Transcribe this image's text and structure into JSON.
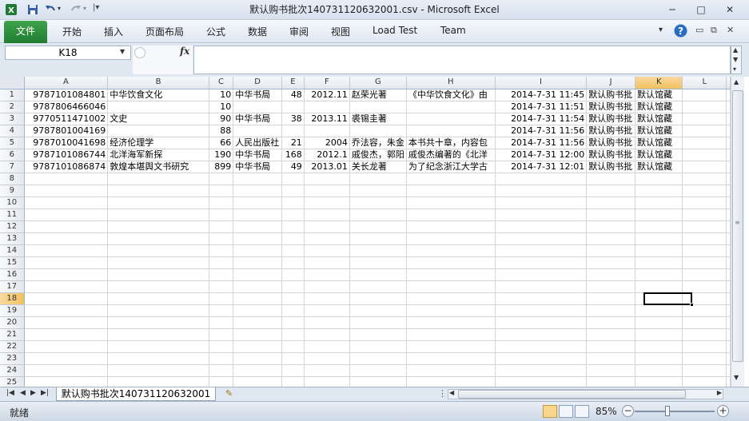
{
  "window": {
    "title": "默认购书批次140731120632001.csv  -  Microsoft Excel",
    "minimize": "─",
    "maximize": "□",
    "close": "✕"
  },
  "ribbon": {
    "tabs": [
      "文件",
      "开始",
      "插入",
      "页面布局",
      "公式",
      "数据",
      "审阅",
      "视图",
      "Load Test",
      "Team"
    ]
  },
  "formula_bar": {
    "name_box": "K18",
    "fx": "fx",
    "content": ""
  },
  "grid": {
    "columns": [
      "A",
      "B",
      "C",
      "D",
      "E",
      "F",
      "G",
      "H",
      "I",
      "J",
      "K",
      "L"
    ],
    "selected_column": "K",
    "selected_row": 18,
    "row_count": 25,
    "rows": [
      [
        "9787101084801",
        "中华饮食文化",
        "10",
        "中华书局",
        "48",
        "2012.11",
        "赵荣光著",
        "《中华饮食文化》由",
        "2014-7-31 11:45",
        "默认购书批",
        "默认馆藏"
      ],
      [
        "9787806466046",
        "",
        "10",
        "",
        "",
        "",
        "",
        "",
        "2014-7-31 11:51",
        "默认购书批",
        "默认馆藏"
      ],
      [
        "9770511471002",
        "文史",
        "90",
        "中华书局",
        "38",
        "2013.11",
        "裘锡圭著",
        "",
        "2014-7-31 11:54",
        "默认购书批",
        "默认馆藏"
      ],
      [
        "9787801004169",
        "",
        "88",
        "",
        "",
        "",
        "",
        "",
        "2014-7-31 11:56",
        "默认购书批",
        "默认馆藏"
      ],
      [
        "9787010041698",
        "经济伦理学",
        "66",
        "人民出版社",
        "21",
        "2004",
        "乔法容，朱金",
        "本书共十章，内容包",
        "2014-7-31 11:56",
        "默认购书批",
        "默认馆藏"
      ],
      [
        "9787101086744",
        "北洋海军新探",
        "190",
        "中华书局",
        "168",
        "2012.1",
        "戚俊杰，郭阳",
        "戚俊杰编著的《北洋",
        "2014-7-31 12:00",
        "默认购书批",
        "默认馆藏"
      ],
      [
        "9787101086874",
        "敦煌本堪舆文书研究",
        "899",
        "中华书局",
        "49",
        "2013.01",
        "关长龙著",
        "为了纪念浙江大学古",
        "2014-7-31 12:01",
        "默认购书批",
        "默认馆藏"
      ]
    ]
  },
  "sheet_tabs": {
    "active": "默认购书批次140731120632001"
  },
  "status_bar": {
    "ready": "就绪",
    "zoom": "85%",
    "zoom_level_percent": 85
  }
}
